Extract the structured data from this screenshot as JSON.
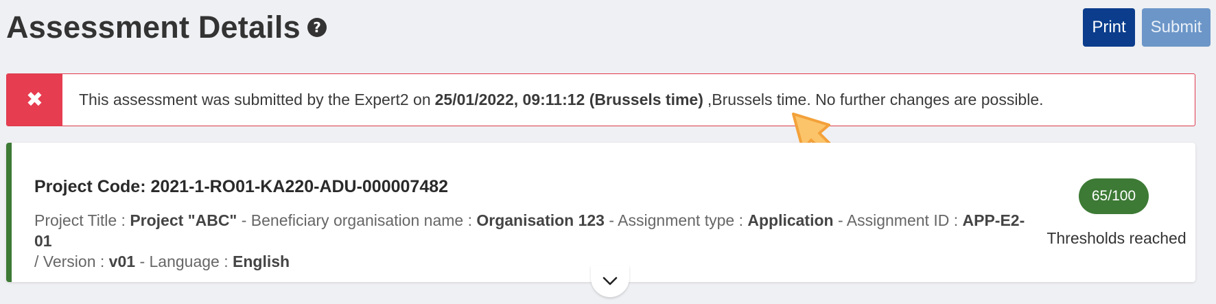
{
  "header": {
    "title": "Assessment Details",
    "help_icon": "question-circle-icon",
    "print_label": "Print",
    "submit_label": "Submit"
  },
  "alert": {
    "icon": "close-icon",
    "text_before": "This assessment was submitted by the Expert2 on",
    "text_bold": "25/01/2022, 09:11:12 (Brussels time)",
    "text_after": ",Brussels time. No further changes are possible."
  },
  "project": {
    "code_line": "Project Code: 2021-1-RO01-KA220-ADU-000007482",
    "title_label": "Project Title :",
    "title_value": "Project \"ABC\"",
    "beneficiary_label": "- Beneficiary organisation name :",
    "beneficiary_value": "Organisation 123",
    "assignment_type_label": "- Assignment type :",
    "assignment_type_value": "Application",
    "assignment_id_label": "- Assignment ID :",
    "assignment_id_value": "APP-E2-01",
    "version_label": "/ Version :",
    "version_value": "v01",
    "language_label": "- Language :",
    "language_value": "English",
    "score": "65/100",
    "threshold_text": "Thresholds reached",
    "expand_icon": "chevron-down-icon"
  },
  "colors": {
    "primary": "#0b3d8c",
    "disabled": "#6c96c8",
    "danger": "#e63d50",
    "success": "#3d7a35"
  }
}
